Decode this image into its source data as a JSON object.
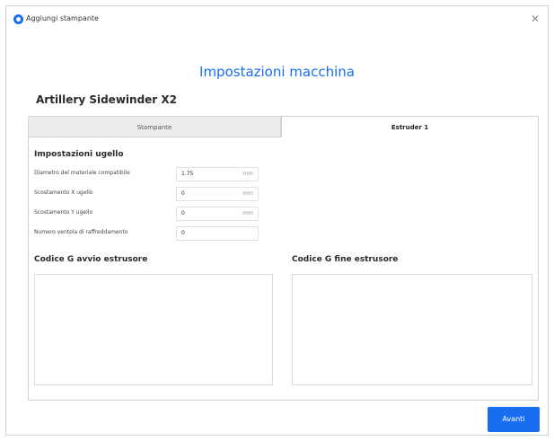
{
  "window": {
    "title": "Aggiungi stampante",
    "close_icon": "close-icon"
  },
  "heading": "Impostazioni macchina",
  "machine_name": "Artillery Sidewinder X2",
  "tabs": [
    {
      "label": "Stampante",
      "active": false
    },
    {
      "label": "Estruder 1",
      "active": true
    }
  ],
  "nozzle_settings": {
    "title": "Impostazioni ugello",
    "fields": [
      {
        "label": "Diametro del materiale compatibile",
        "value": "1.75",
        "unit": "mm"
      },
      {
        "label": "Scostamento X ugello",
        "value": "0",
        "unit": "mm"
      },
      {
        "label": "Scostamento Y ugello",
        "value": "0",
        "unit": "mm"
      },
      {
        "label": "Numero ventola di raffreddamento",
        "value": "0",
        "unit": ""
      }
    ]
  },
  "gcode": {
    "start_label": "Codice G avvio estrusore",
    "start_value": "",
    "end_label": "Codice G fine estrusore",
    "end_value": ""
  },
  "footer": {
    "next_label": "Avanti"
  },
  "colors": {
    "accent": "#196ef0",
    "border": "#d0d0d0",
    "tab_inactive_bg": "#ececec"
  }
}
